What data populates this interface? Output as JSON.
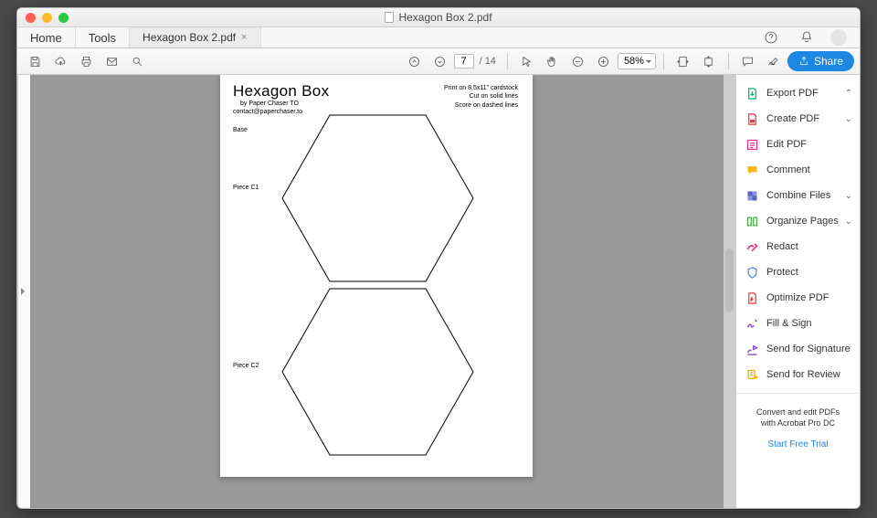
{
  "window": {
    "title": "Hexagon Box 2.pdf"
  },
  "tabs": {
    "home": "Home",
    "tools": "Tools",
    "doc": "Hexagon Box 2.pdf"
  },
  "toolbar": {
    "page_current": "7",
    "page_total": "/  14",
    "zoom": "58%",
    "share": "Share"
  },
  "document": {
    "title": "Hexagon Box",
    "byline": "by Paper Chaser TO",
    "email": "contact@paperchaser.to",
    "instructions": [
      "Print on 8.5x11\" cardstock",
      "Cut on solid lines",
      "Score on dashed lines"
    ],
    "labels": {
      "base": "Base",
      "c1": "Piece C1",
      "c2": "Piece C2"
    }
  },
  "tools_panel": {
    "items": [
      {
        "label": "Export PDF",
        "icon": "export",
        "color": "#0faf6c",
        "chevron": "up"
      },
      {
        "label": "Create PDF",
        "icon": "create",
        "color": "#e8353d",
        "chevron": "down"
      },
      {
        "label": "Edit PDF",
        "icon": "edit",
        "color": "#ec2f8b",
        "chevron": null
      },
      {
        "label": "Comment",
        "icon": "comment",
        "color": "#f7b516",
        "chevron": null
      },
      {
        "label": "Combine Files",
        "icon": "combine",
        "color": "#5862c7",
        "chevron": "down"
      },
      {
        "label": "Organize Pages",
        "icon": "organize",
        "color": "#3caf3f",
        "chevron": "down"
      },
      {
        "label": "Redact",
        "icon": "redact",
        "color": "#e2287e",
        "chevron": null
      },
      {
        "label": "Protect",
        "icon": "protect",
        "color": "#4f8be0",
        "chevron": null
      },
      {
        "label": "Optimize PDF",
        "icon": "optimize",
        "color": "#ea3b3b",
        "chevron": null
      },
      {
        "label": "Fill & Sign",
        "icon": "fillsign",
        "color": "#8b4cc5",
        "chevron": null
      },
      {
        "label": "Send for Signature",
        "icon": "sendsig",
        "color": "#7a3bc3",
        "chevron": null
      },
      {
        "label": "Send for Review",
        "icon": "sendrev",
        "color": "#e9b200",
        "chevron": null
      }
    ]
  },
  "promo": {
    "text1": "Convert and edit PDFs",
    "text2": "with Acrobat Pro DC",
    "link": "Start Free Trial"
  }
}
